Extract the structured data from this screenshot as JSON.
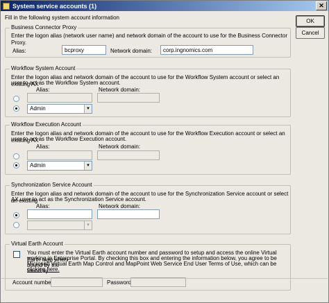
{
  "window": {
    "title": "System service accounts (1)",
    "close_glyph": "✕"
  },
  "instructions": "Fill in the following system account information",
  "buttons": {
    "ok": "OK",
    "cancel": "Cancel"
  },
  "business_connector": {
    "legend": "Business Connector Proxy",
    "description": "Enter the logon alias (network user name) and network domain of the account to use for the Business Connector Proxy.",
    "alias_label": "Alias:",
    "alias_value": "bcproxy",
    "domain_label": "Network domain:",
    "domain_value": "corp.ingnomics.com"
  },
  "workflow_system": {
    "legend": "Workflow System Account",
    "description_line1": "Enter the logon alias and network domain of the account to use for the Workflow System account or select an existing AX",
    "description_line2": "user to act as the Workflow System account.",
    "alias_label": "Alias:",
    "domain_label": "Network domain:",
    "selected_user": "Admin"
  },
  "workflow_execution": {
    "legend": "Workflow Execution Account",
    "description_line1": "Enter the logon alias and network domain of the account to use for the Workflow Execution account or select an existing AX",
    "description_line2": "user to act as the Workflow Execution account.",
    "alias_label": "Alias:",
    "domain_label": "Network domain:",
    "selected_user": "Admin"
  },
  "synchronization": {
    "legend": "Synchronization Service Account",
    "description_line1": "Enter the logon alias and network domain of the account to use for the Synchronization Service account or select an existing",
    "description_line2": "AX user to act as the  Synchronization Service account.",
    "alias_label": "Alias:",
    "domain_label": "Network domain:",
    "selected_user": ""
  },
  "virtual_earth": {
    "legend": "Virtual Earth Account",
    "text_line1": "You must enter the Virtual Earth account number and password to setup and access the online Virtual Earth map when",
    "text_line2": "working in Enterprise Portal. By checking this box and entering the information below, you agree to be bound by the",
    "text_line3": "Microsoft Virtual Earth Map Control and MapPoint Web Service End User Terms of Use, which can be found by",
    "link_text": "clicking here.",
    "account_label": "Account number:",
    "password_label": "Password:"
  },
  "icons": {
    "title": "window-icon",
    "dropdown": "chevron-down-icon",
    "close": "close-icon"
  }
}
